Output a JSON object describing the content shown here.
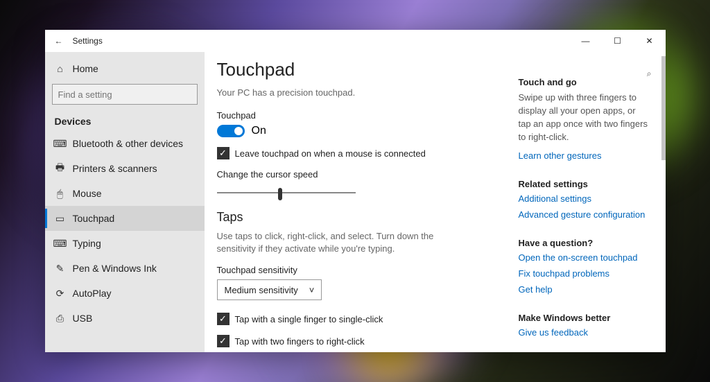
{
  "window": {
    "title": "Settings"
  },
  "home": "Home",
  "search": {
    "placeholder": "Find a setting"
  },
  "category": "Devices",
  "nav": [
    {
      "label": "Bluetooth & other devices",
      "icon": "⌨"
    },
    {
      "label": "Printers & scanners",
      "icon": "🖶"
    },
    {
      "label": "Mouse",
      "icon": "🖱"
    },
    {
      "label": "Touchpad",
      "icon": "▭",
      "selected": true
    },
    {
      "label": "Typing",
      "icon": "⌨"
    },
    {
      "label": "Pen & Windows Ink",
      "icon": "✎"
    },
    {
      "label": "AutoPlay",
      "icon": "⟳"
    },
    {
      "label": "USB",
      "icon": "⎙"
    }
  ],
  "page": {
    "title": "Touchpad",
    "subtitle": "Your PC has a precision touchpad.",
    "touchpad_label": "Touchpad",
    "toggle_state": "On",
    "leave_on": "Leave touchpad on when a mouse is connected",
    "cursor_speed": "Change the cursor speed",
    "taps_heading": "Taps",
    "taps_desc": "Use taps to click, right-click, and select. Turn down the sensitivity if they activate while you're typing.",
    "sensitivity_label": "Touchpad sensitivity",
    "sensitivity_value": "Medium sensitivity",
    "tap1": "Tap with a single finger to single-click",
    "tap2": "Tap with two fingers to right-click"
  },
  "aside": {
    "touch_and_go": "Touch and go",
    "touch_and_go_desc": "Swipe up with three fingers to display all your open apps, or tap an app once with two fingers to right-click.",
    "learn_gestures": "Learn other gestures",
    "related": "Related settings",
    "additional": "Additional settings",
    "advanced": "Advanced gesture configuration",
    "question": "Have a question?",
    "q1": "Open the on-screen touchpad",
    "q2": "Fix touchpad problems",
    "q3": "Get help",
    "better": "Make Windows better",
    "feedback": "Give us feedback"
  }
}
